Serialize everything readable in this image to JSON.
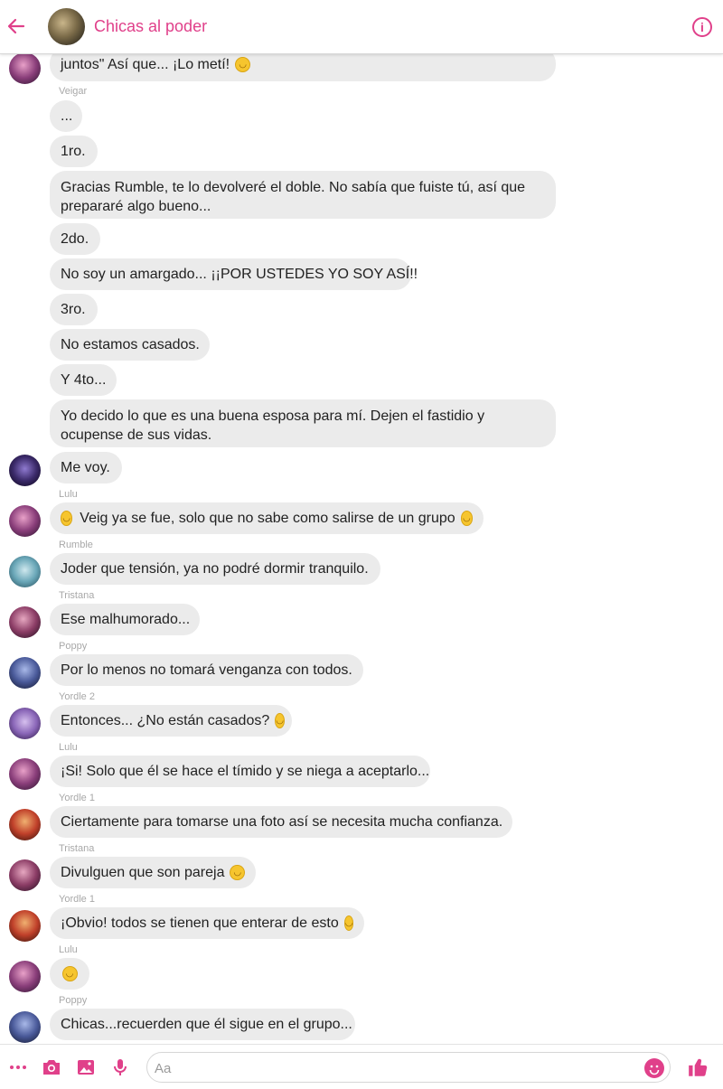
{
  "header": {
    "title": "Chicas al poder"
  },
  "messages": [
    {
      "text": "juntos\" Así que... ¡Lo metí!",
      "emoji": "blush"
    },
    {
      "sender": "Veigar",
      "text": "..."
    },
    {
      "text": "1ro."
    },
    {
      "text": "Gracias Rumble, te lo devolveré el doble. No sabía que fuiste tú, así que prepararé algo bueno..."
    },
    {
      "text": "2do."
    },
    {
      "text": "No soy un amargado... ¡¡POR USTEDES YO SOY ASÍ!!"
    },
    {
      "text": "3ro."
    },
    {
      "text": "No estamos casados."
    },
    {
      "text": "Y 4to..."
    },
    {
      "text": "Yo decido lo que es una buena esposa para mí. Dejen el fastidio y ocupense de sus vidas."
    },
    {
      "text": "Me voy."
    },
    {
      "sender": "Lulu",
      "text": "Veig ya se fue, solo que no sabe como salirse de un grupo",
      "emoji_lead": "hug",
      "emoji": "laugh"
    },
    {
      "sender": "Rumble",
      "text": "Joder que tensión, ya no podré dormir tranquilo."
    },
    {
      "sender": "Tristana",
      "text": "Ese malhumorado..."
    },
    {
      "sender": "Poppy",
      "text": "Por lo menos no tomará venganza con todos."
    },
    {
      "sender": "Yordle 2",
      "text": "Entonces... ¿No están casados?",
      "emoji": "kiss"
    },
    {
      "sender": "Lulu",
      "text": "¡Si! Solo que él se hace el tímido y se niega a aceptarlo..."
    },
    {
      "sender": "Yordle 1",
      "text": "Ciertamente para tomarse una foto así se necesita mucha confianza."
    },
    {
      "sender": "Tristana",
      "text": "Divulguen que son pareja",
      "emoji": "smirk"
    },
    {
      "sender": "Yordle 1",
      "text": "¡Obvio! todos se tienen que enterar de esto",
      "emoji": "shush"
    },
    {
      "sender": "Lulu",
      "text": "",
      "emoji": "smile"
    },
    {
      "sender": "Poppy",
      "text": "Chicas...recuerden que él sigue en el grupo..."
    }
  ],
  "composer": {
    "placeholder": "Aa"
  },
  "colors": {
    "accent": "#e0408a",
    "bubble": "#ebebeb"
  }
}
